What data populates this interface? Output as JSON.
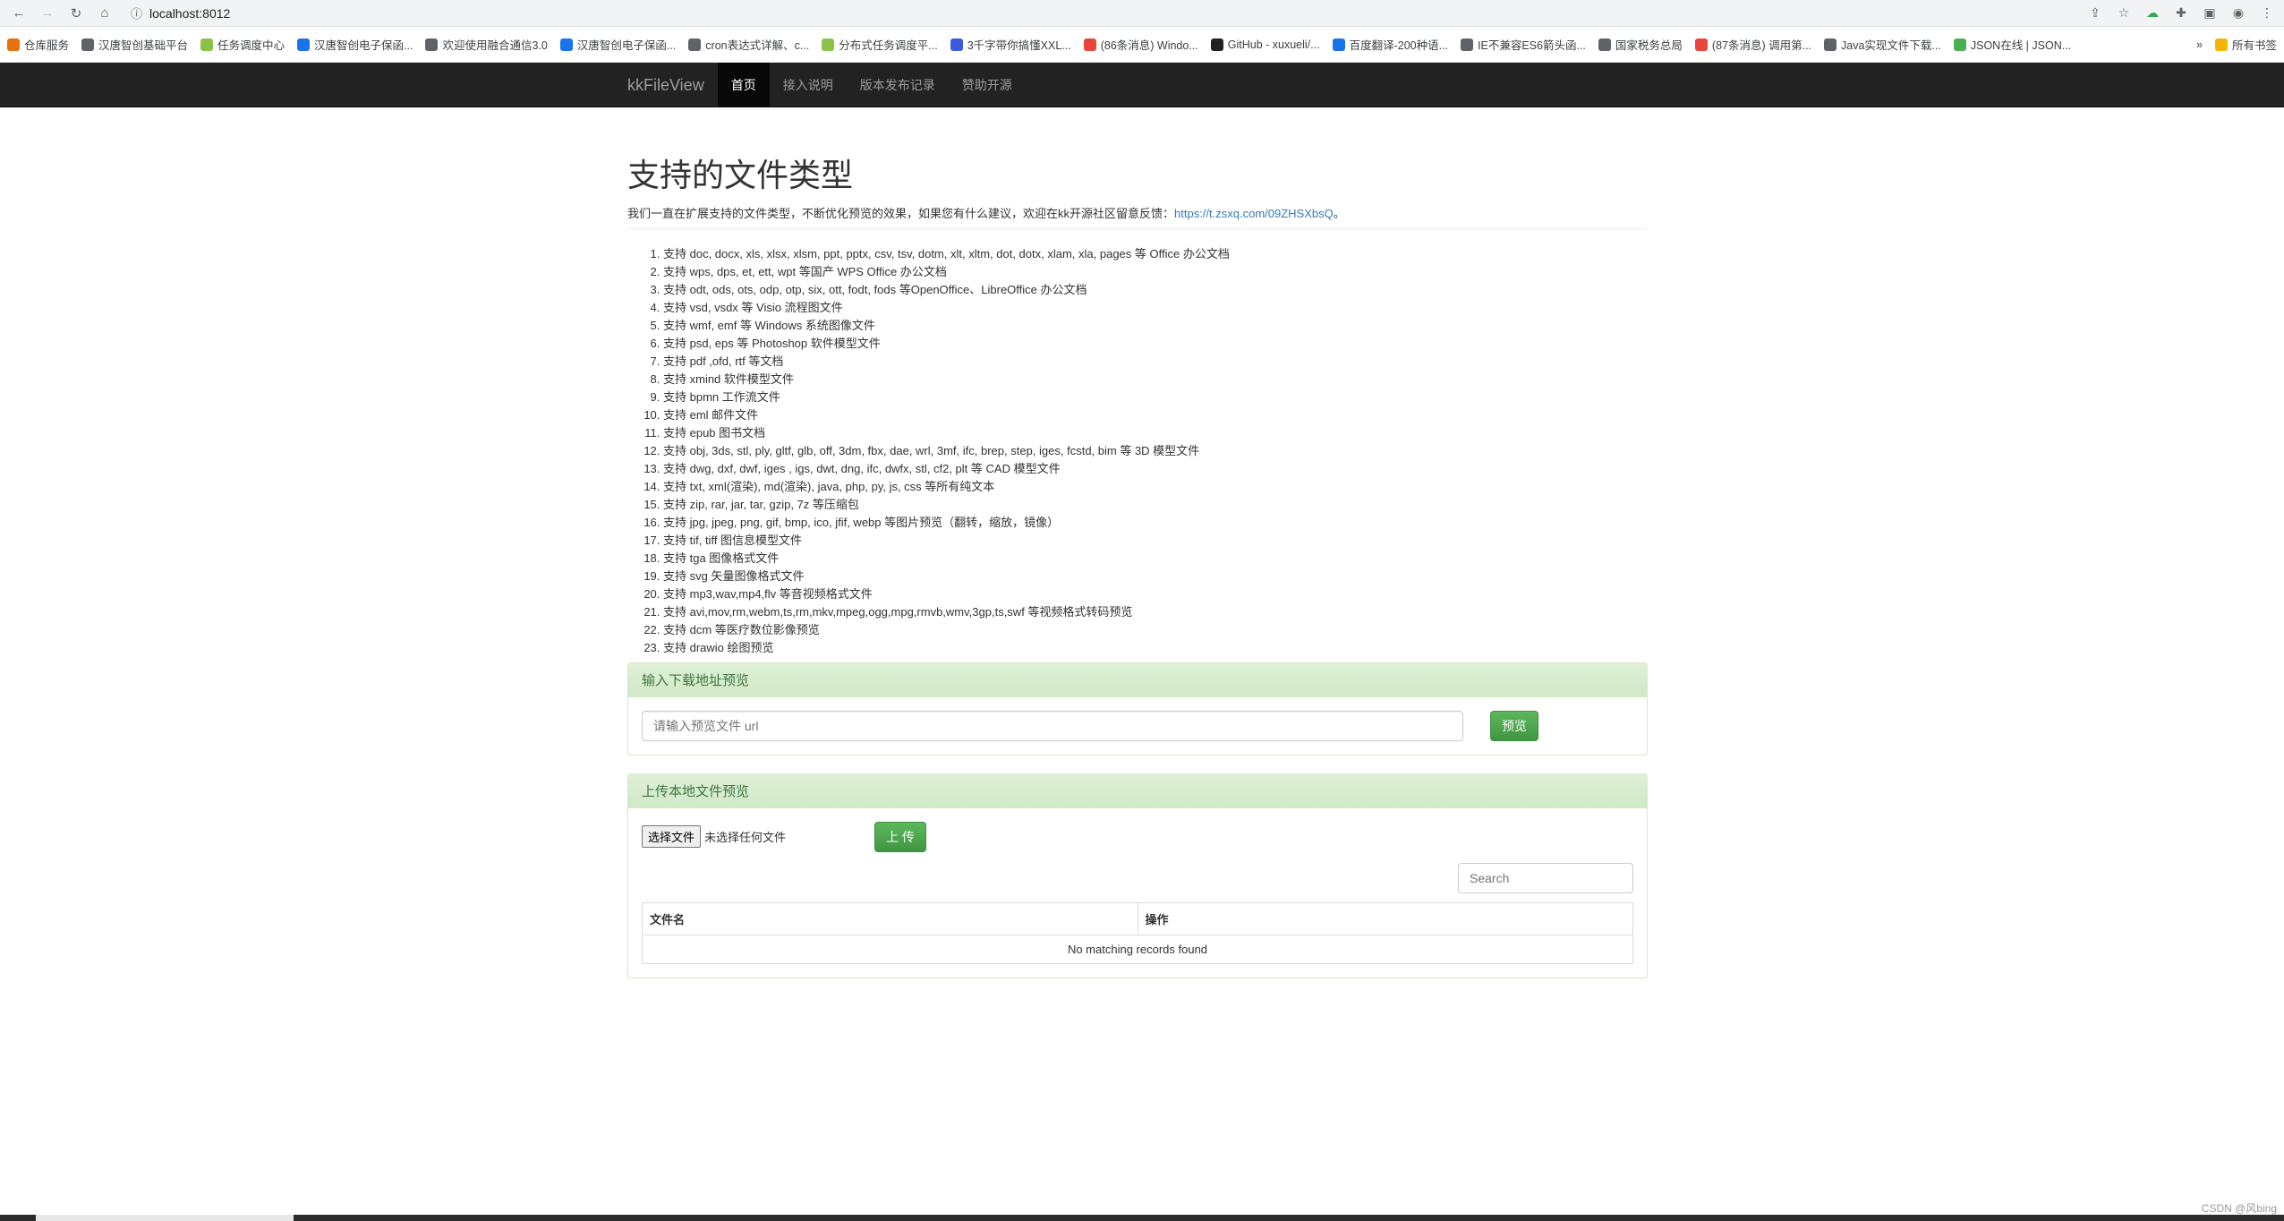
{
  "browser": {
    "url": "localhost:8012",
    "bookmarks": [
      {
        "label": "仓库服务",
        "color": "#e8710a"
      },
      {
        "label": "汉唐智创基础平台",
        "color": "#5f6368"
      },
      {
        "label": "任务调度中心",
        "color": "#8bc34a"
      },
      {
        "label": "汉唐智创电子保函...",
        "color": "#1a73e8"
      },
      {
        "label": "欢迎使用融合通信3.0",
        "color": "#5f6368"
      },
      {
        "label": "汉唐智创电子保函...",
        "color": "#1a73e8"
      },
      {
        "label": "cron表达式详解、c...",
        "color": "#5f6368"
      },
      {
        "label": "分布式任务调度平...",
        "color": "#8bc34a"
      },
      {
        "label": "3千字带你搞懂XXL...",
        "color": "#3b5bdb"
      },
      {
        "label": "(86条消息) Windo...",
        "color": "#e8453c"
      },
      {
        "label": "GitHub - xuxueli/...",
        "color": "#202124"
      },
      {
        "label": "百度翻译-200种语...",
        "color": "#1a73e8"
      },
      {
        "label": "IE不兼容ES6箭头函...",
        "color": "#5f6368"
      },
      {
        "label": "国家税务总局",
        "color": "#5f6368"
      },
      {
        "label": "(87条消息) 调用第...",
        "color": "#e8453c"
      },
      {
        "label": "Java实现文件下载...",
        "color": "#5f6368"
      },
      {
        "label": "JSON在线 | JSON...",
        "color": "#4caf50"
      }
    ],
    "bookmarks_more": "»",
    "all_bookmarks": "所有书签"
  },
  "navbar": {
    "brand": "kkFileView",
    "items": [
      {
        "label": "首页",
        "active": true
      },
      {
        "label": "接入说明",
        "active": false
      },
      {
        "label": "版本发布记录",
        "active": false
      },
      {
        "label": "赞助开源",
        "active": false
      }
    ]
  },
  "header": {
    "title": "支持的文件类型",
    "intro": "我们一直在扩展支持的文件类型，不断优化预览的效果，如果您有什么建议，欢迎在kk开源社区留意反馈：",
    "link": "https://t.zsxq.com/09ZHSXbsQ",
    "intro_end": "。"
  },
  "types": [
    "支持 doc, docx, xls, xlsx, xlsm, ppt, pptx, csv, tsv, dotm, xlt, xltm, dot, dotx, xlam, xla, pages 等 Office 办公文档",
    "支持 wps, dps, et, ett, wpt 等国产 WPS Office 办公文档",
    "支持 odt, ods, ots, odp, otp, six, ott, fodt, fods 等OpenOffice、LibreOffice 办公文档",
    "支持 vsd, vsdx 等 Visio 流程图文件",
    "支持 wmf, emf 等 Windows 系统图像文件",
    "支持 psd, eps 等 Photoshop 软件模型文件",
    "支持 pdf ,ofd, rtf 等文档",
    "支持 xmind 软件模型文件",
    "支持 bpmn 工作流文件",
    "支持 eml 邮件文件",
    "支持 epub 图书文档",
    "支持 obj, 3ds, stl, ply, gltf, glb, off, 3dm, fbx, dae, wrl, 3mf, ifc, brep, step, iges, fcstd, bim 等 3D 模型文件",
    "支持 dwg, dxf, dwf, iges , igs, dwt, dng, ifc, dwfx, stl, cf2, plt 等 CAD 模型文件",
    "支持 txt, xml(渲染), md(渲染), java, php, py, js, css 等所有纯文本",
    "支持 zip, rar, jar, tar, gzip, 7z 等压缩包",
    "支持 jpg, jpeg, png, gif, bmp, ico, jfif, webp 等图片预览（翻转，缩放，镜像）",
    "支持 tif, tiff 图信息模型文件",
    "支持 tga 图像格式文件",
    "支持 svg 矢量图像格式文件",
    "支持 mp3,wav,mp4,flv 等音视频格式文件",
    "支持 avi,mov,rm,webm,ts,rm,mkv,mpeg,ogg,mpg,rmvb,wmv,3gp,ts,swf 等视频格式转码预览",
    "支持 dcm 等医疗数位影像预览",
    "支持 drawio 绘图预览"
  ],
  "url_panel": {
    "title": "输入下载地址预览",
    "placeholder": "请输入预览文件 url",
    "button": "预览"
  },
  "upload_panel": {
    "title": "上传本地文件预览",
    "choose_button": "选择文件",
    "no_file": "未选择任何文件",
    "upload_button": "上 传",
    "search_placeholder": "Search",
    "columns": [
      "文件名",
      "操作"
    ],
    "empty_text": "No matching records found"
  },
  "watermark": "CSDN @风bing"
}
